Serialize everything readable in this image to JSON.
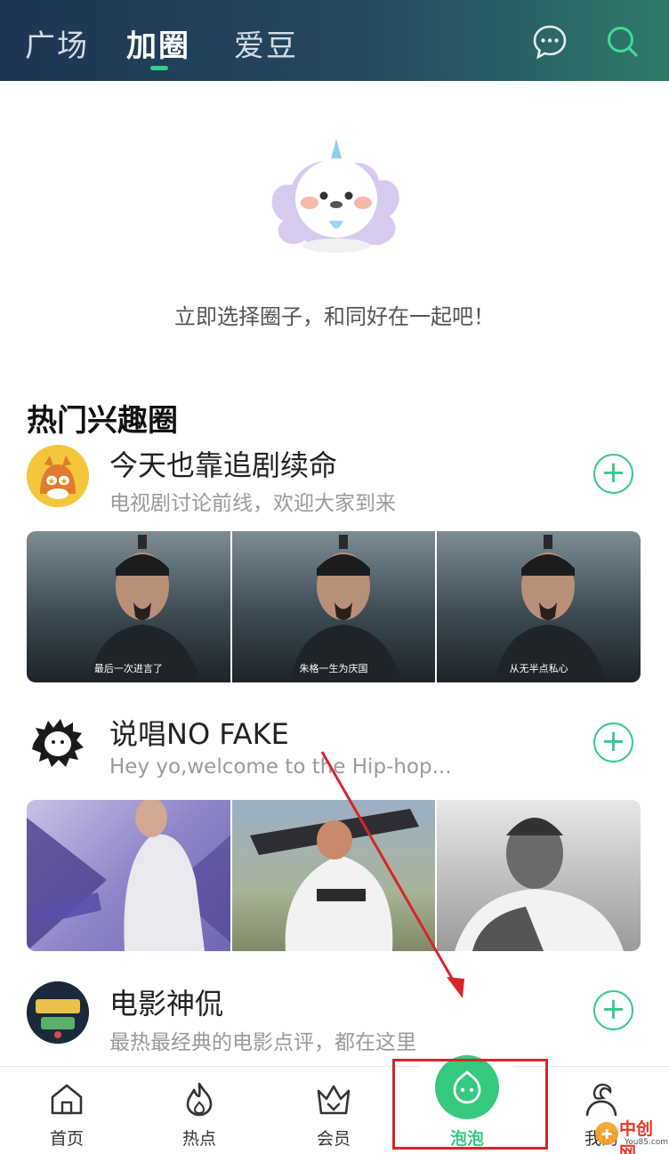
{
  "header": {
    "tabs": [
      {
        "label": "广场",
        "active": false
      },
      {
        "label": "加圈",
        "active": true
      },
      {
        "label": "爱豆",
        "active": false
      }
    ],
    "icons": [
      "message-icon",
      "search-icon"
    ],
    "gradient": [
      "#1f3553",
      "#2f7a6a"
    ],
    "accent": "#2fd08f"
  },
  "empty_state": {
    "text": "立即选择圈子，和同好在一起吧！"
  },
  "hot_circles": {
    "title": "热门兴趣圈",
    "items": [
      {
        "name": "今天也靠追剧续命",
        "desc": "电视剧讨论前线，欢迎大家到来",
        "thumbs": [
          "最后一次进言了",
          "朱格一生为庆国",
          "从无半点私心"
        ]
      },
      {
        "name": "说唱NO FAKE",
        "desc": "Hey yo,welcome to the Hip-hop...",
        "thumbs": [
          "",
          "",
          ""
        ]
      },
      {
        "name": "电影神侃",
        "desc": "最热最经典的电影点评，都在这里",
        "thumbs": []
      }
    ],
    "add_symbol": "+"
  },
  "nav": {
    "items": [
      {
        "label": "首页",
        "icon": "home-icon"
      },
      {
        "label": "热点",
        "icon": "flame-icon"
      },
      {
        "label": "会员",
        "icon": "crown-icon"
      },
      {
        "label": "泡泡",
        "icon": "bubble-icon",
        "active": true
      },
      {
        "label": "我的",
        "icon": "profile-icon"
      }
    ],
    "active_color": "#35c97f"
  },
  "annotations": {
    "highlight_color": "#d8242a"
  },
  "watermark": {
    "text": "中创网",
    "sub": "You85.com"
  }
}
